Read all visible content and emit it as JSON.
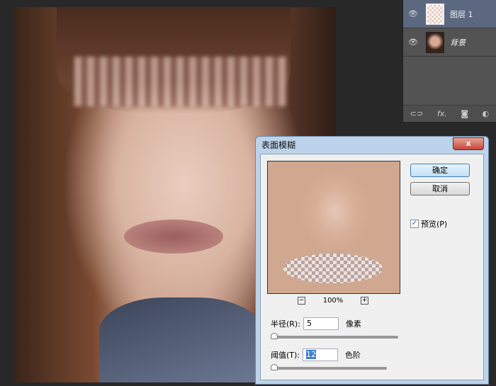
{
  "layers": {
    "items": [
      {
        "name": "图层 1",
        "selected": true
      },
      {
        "name": "背景",
        "selected": false
      }
    ],
    "footer_icons": [
      "link-icon",
      "fx-icon",
      "mask-icon",
      "adjustment-icon"
    ],
    "fx_label": "fx."
  },
  "dialog": {
    "title": "表面模糊",
    "close_label": "x",
    "ok_label": "确定",
    "cancel_label": "取消",
    "preview_label": "预览(P)",
    "preview_checked": true,
    "zoom_level": "100%",
    "zoom_out": "−",
    "zoom_in": "+",
    "radius_label": "半径(R):",
    "radius_value": "5",
    "radius_unit": "像素",
    "threshold_label": "阈值(T):",
    "threshold_value": "12",
    "threshold_unit": "色阶"
  }
}
